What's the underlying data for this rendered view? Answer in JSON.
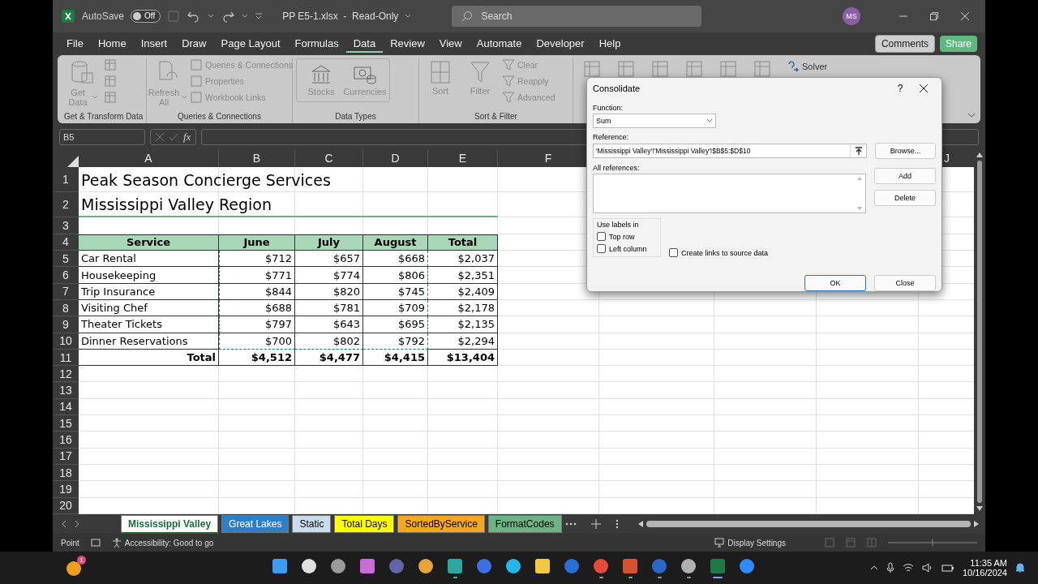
{
  "title_bar": {
    "autosave_label": "AutoSave",
    "autosave": {
      "on": false,
      "label": "Off"
    },
    "document_title": "PP E5-1.xlsx  -  Read-Only",
    "search": {
      "placeholder": "Search"
    },
    "avatar": "MS"
  },
  "menu": {
    "tabs": [
      {
        "label": "File",
        "selected": false
      },
      {
        "label": "Home",
        "selected": false
      },
      {
        "label": "Insert",
        "selected": false
      },
      {
        "label": "Draw",
        "selected": false
      },
      {
        "label": "Page Layout",
        "selected": false
      },
      {
        "label": "Formulas",
        "selected": false
      },
      {
        "label": "Data",
        "selected": true
      },
      {
        "label": "Review",
        "selected": false
      },
      {
        "label": "View",
        "selected": false
      },
      {
        "label": "Automate",
        "selected": false
      },
      {
        "label": "Developer",
        "selected": false
      },
      {
        "label": "Help",
        "selected": false
      }
    ],
    "comments": "Comments",
    "share": "Share"
  },
  "ribbon": {
    "groups": [
      {
        "label": "Get & Transform Data",
        "large": [
          {
            "label": "Get Data",
            "caret": true
          }
        ]
      },
      {
        "label": "Queries & Connections",
        "large": [
          {
            "label": "Refresh All",
            "caret": true
          }
        ],
        "small": [
          "Queries & Connections",
          "Properties",
          "Workbook Links"
        ]
      },
      {
        "label": "Data Types",
        "large": [
          {
            "label": "Stocks",
            "caret": false
          },
          {
            "label": "Currencies",
            "caret": false
          }
        ]
      },
      {
        "label": "Sort & Filter",
        "large": [
          {
            "label": "Sort",
            "caret": false
          },
          {
            "label": "Filter",
            "caret": false
          }
        ],
        "small": [
          "Clear",
          "Reapply",
          "Advanced"
        ]
      }
    ],
    "solver": "Solver"
  },
  "formula_bar": {
    "name_box": "B5",
    "fx": "fx"
  },
  "sheet": {
    "columns": [
      "A",
      "B",
      "C",
      "D",
      "E",
      "F",
      "J"
    ],
    "rows": [
      {
        "number": "1",
        "kind": "title",
        "cells": [
          "Peak Season Concierge Services"
        ]
      },
      {
        "number": "2",
        "kind": "title",
        "cells": [
          "Mississippi Valley Region"
        ]
      },
      {
        "number": "3",
        "kind": "blank",
        "cells": []
      },
      {
        "number": "4",
        "kind": "header",
        "cells": [
          "Service",
          "June",
          "July",
          "August",
          "Total"
        ]
      },
      {
        "number": "5",
        "kind": "data",
        "in_reference": true,
        "cells": [
          "Car Rental",
          "$712",
          "$657",
          "$668",
          "$2,037"
        ]
      },
      {
        "number": "6",
        "kind": "data",
        "in_reference": true,
        "cells": [
          "Housekeeping",
          "$771",
          "$774",
          "$806",
          "$2,351"
        ]
      },
      {
        "number": "7",
        "kind": "data",
        "in_reference": true,
        "cells": [
          "Trip Insurance",
          "$844",
          "$820",
          "$745",
          "$2,409"
        ]
      },
      {
        "number": "8",
        "kind": "data",
        "in_reference": true,
        "cells": [
          "Visiting Chef",
          "$688",
          "$781",
          "$709",
          "$2,178"
        ]
      },
      {
        "number": "9",
        "kind": "data",
        "in_reference": true,
        "cells": [
          "Theater Tickets",
          "$797",
          "$643",
          "$695",
          "$2,135"
        ]
      },
      {
        "number": "10",
        "kind": "data",
        "in_reference": true,
        "cells": [
          "Dinner Reservations",
          "$700",
          "$802",
          "$792",
          "$2,294"
        ]
      },
      {
        "number": "11",
        "kind": "total",
        "cells": [
          "Total",
          "$4,512",
          "$4,477",
          "$4,415",
          "$13,404"
        ]
      },
      {
        "number": "12",
        "kind": "blank",
        "cells": []
      },
      {
        "number": "13",
        "kind": "blank",
        "cells": []
      },
      {
        "number": "14",
        "kind": "blank",
        "cells": []
      },
      {
        "number": "15",
        "kind": "blank",
        "cells": []
      },
      {
        "number": "16",
        "kind": "blank",
        "cells": []
      },
      {
        "number": "17",
        "kind": "blank",
        "cells": []
      },
      {
        "number": "18",
        "kind": "blank",
        "cells": []
      },
      {
        "number": "19",
        "kind": "blank",
        "cells": []
      },
      {
        "number": "20",
        "kind": "blank",
        "cells": []
      }
    ]
  },
  "sheet_tabs": [
    {
      "label": "Mississippi Valley",
      "selected": true,
      "color": "#ffffff"
    },
    {
      "label": "Great Lakes",
      "selected": false,
      "color": "#2f7fc8"
    },
    {
      "label": "Static",
      "selected": false,
      "color": "#c9dcf0"
    },
    {
      "label": "Total Days",
      "selected": false,
      "color": "#ffff00"
    },
    {
      "label": "SortedByService",
      "selected": false,
      "color": "#f5a623"
    },
    {
      "label": "FormatCodes",
      "selected": false,
      "color": "#6fb384"
    }
  ],
  "status_bar": {
    "mode": "Point",
    "accessibility": "Accessibility: Good to go",
    "display_settings": "Display Settings"
  },
  "dialog": {
    "title": "Consolidate",
    "help": "?",
    "function_label": "Function:",
    "function_value": "Sum",
    "reference_label": "Reference:",
    "reference_value": "'Mississippi Valley'!'Mississippi Valley'!$B$5:$D$10",
    "all_references_label": "All references:",
    "browse": "Browse...",
    "add": "Add",
    "delete": "Delete",
    "labels_group": "Use labels in",
    "checkboxes": [
      {
        "label": "Top row",
        "checked": false
      },
      {
        "label": "Left column",
        "checked": false
      },
      {
        "label": "Create links to source data",
        "checked": false
      }
    ],
    "ok": "OK",
    "close": "Close"
  },
  "taskbar": {
    "notification_badge": "1",
    "apps": [
      {
        "color": "#3b9cf2",
        "running": false,
        "active": false
      },
      {
        "color": "#e0e0e0",
        "running": false,
        "active": false
      },
      {
        "color": "#9a9a9a",
        "running": false,
        "active": false
      },
      {
        "color": "#c86dd7",
        "running": false,
        "active": false
      },
      {
        "color": "#6264a7",
        "running": false,
        "active": false
      },
      {
        "color": "#e8a33a",
        "running": false,
        "active": false
      },
      {
        "color": "#2fa7a0",
        "running": true,
        "active": false
      },
      {
        "color": "#3d6fe0",
        "running": false,
        "active": false
      },
      {
        "color": "#23b8e8",
        "running": false,
        "active": false
      },
      {
        "color": "#f2c744",
        "running": false,
        "active": false
      },
      {
        "color": "#2a6fd6",
        "running": false,
        "active": false
      },
      {
        "color": "#e64a3b",
        "running": true,
        "active": false
      },
      {
        "color": "#d35230",
        "running": true,
        "active": false
      },
      {
        "color": "#2b67c6",
        "running": true,
        "active": false
      },
      {
        "color": "#b0b0b0",
        "running": true,
        "active": false
      },
      {
        "color": "#1d7a45",
        "running": true,
        "active": true
      },
      {
        "color": "#2d8cff",
        "running": false,
        "active": false
      }
    ],
    "time": "11:35 AM",
    "date": "10/16/2024"
  }
}
